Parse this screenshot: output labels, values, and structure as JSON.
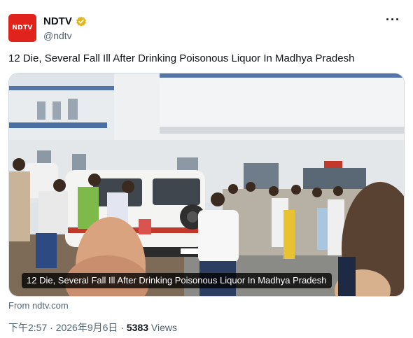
{
  "tweet": {
    "avatar_text": "NDTV",
    "display_name": "NDTV",
    "handle": "@ndtv",
    "more_label": "···",
    "text": "12 Die, Several Fall Ill After Drinking Poisonous Liquor In Madhya Pradesh"
  },
  "card": {
    "image_icon": "news-photo",
    "caption": "12 Die, Several Fall Ill After Drinking Poisonous Liquor In Madhya Pradesh",
    "source": "From ndtv.com"
  },
  "meta": {
    "time": "下午2:57",
    "separator": "·",
    "date": "2026年9月6日",
    "views_count": "5383",
    "views_label": "Views"
  },
  "colors": {
    "brand_red": "#e1241b",
    "verified_gold": "#e2b719",
    "secondary_text": "#536471"
  }
}
